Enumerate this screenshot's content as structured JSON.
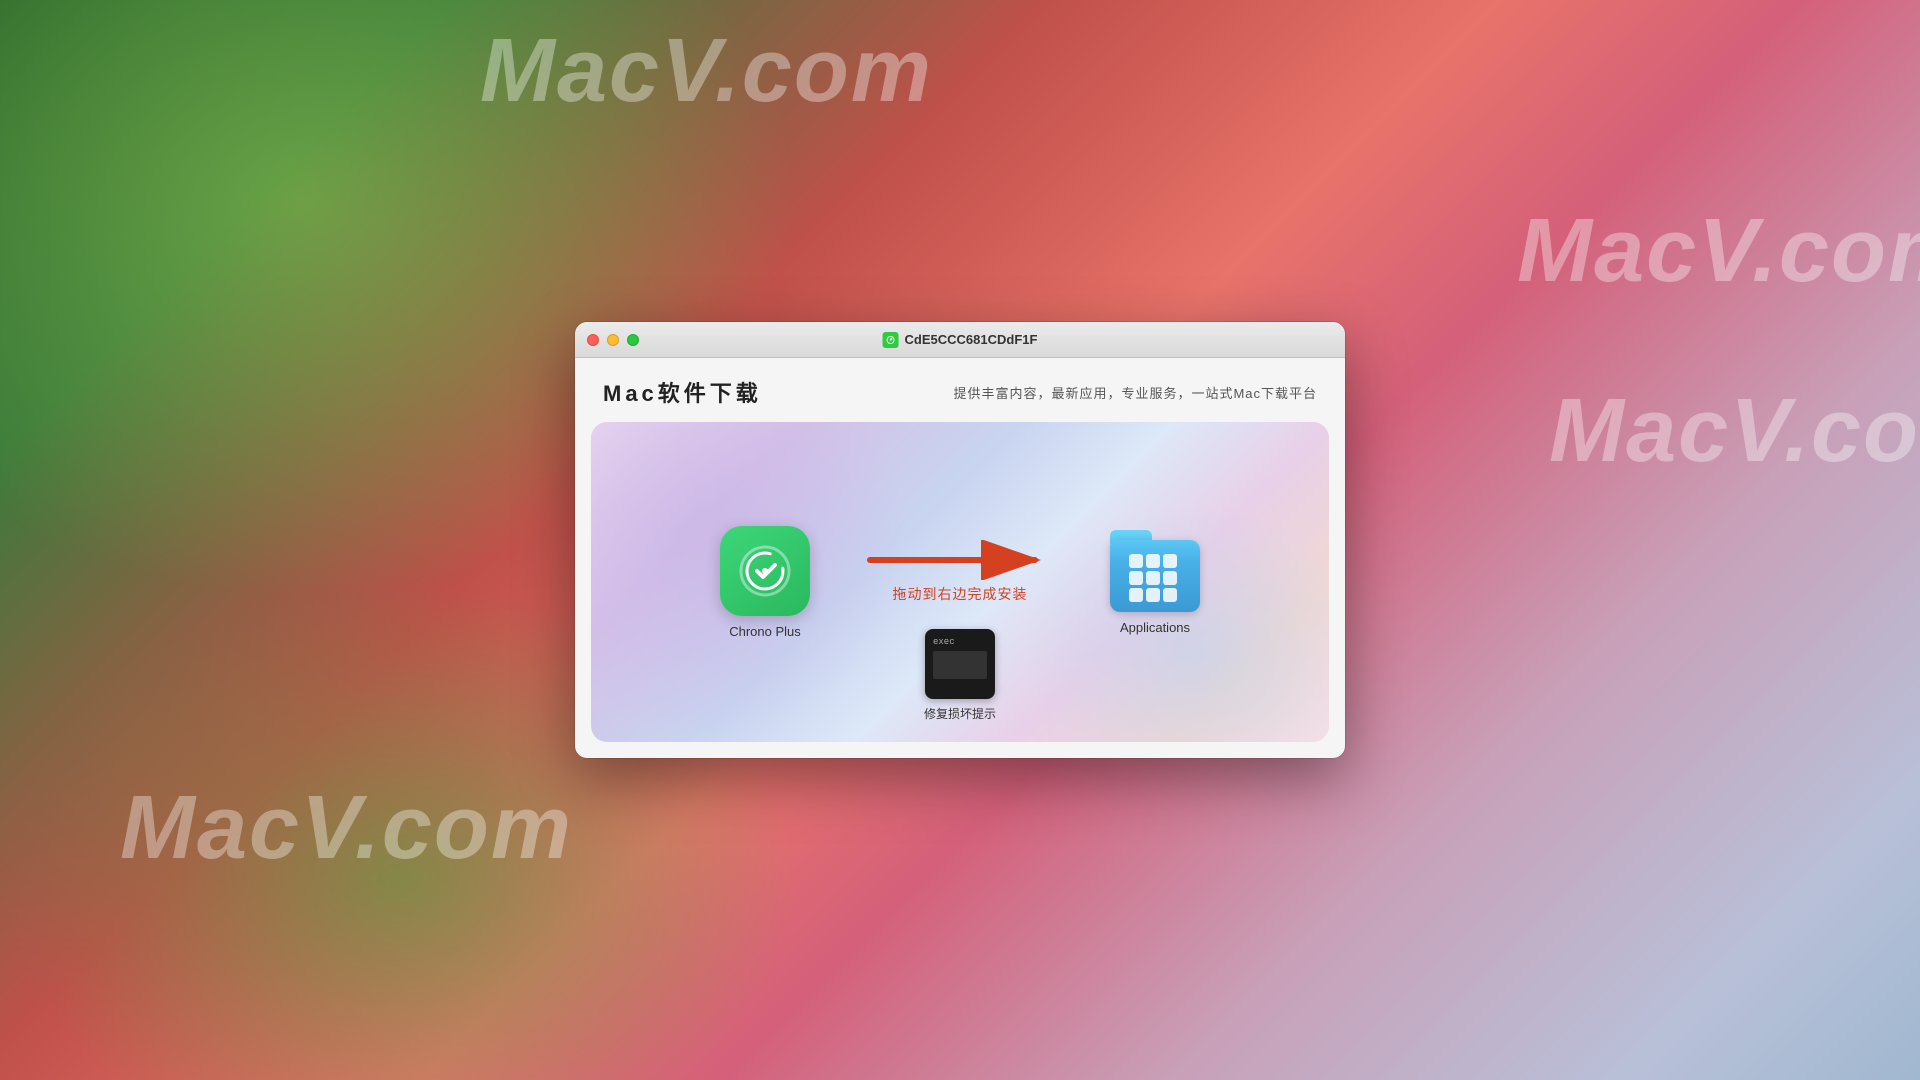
{
  "desktop": {
    "watermarks": [
      "MacV.com",
      "MacV.com",
      "MacV.com",
      "MacV.com"
    ]
  },
  "window": {
    "title": "CdE5CCC681CDdF1F",
    "title_icon": "🟩",
    "traffic_lights": {
      "close": "close",
      "minimize": "minimize",
      "maximize": "maximize"
    }
  },
  "header": {
    "brand": "Mac软件下载",
    "subtitle": "提供丰富内容，最新应用，专业服务，一站式Mac下载平台"
  },
  "installer": {
    "app_name": "Chrono Plus",
    "arrow_label": "拖动到右边完成安装",
    "folder_label": "Applications",
    "exec_label": "exec",
    "exec_section_label": "修复损坏提示"
  }
}
